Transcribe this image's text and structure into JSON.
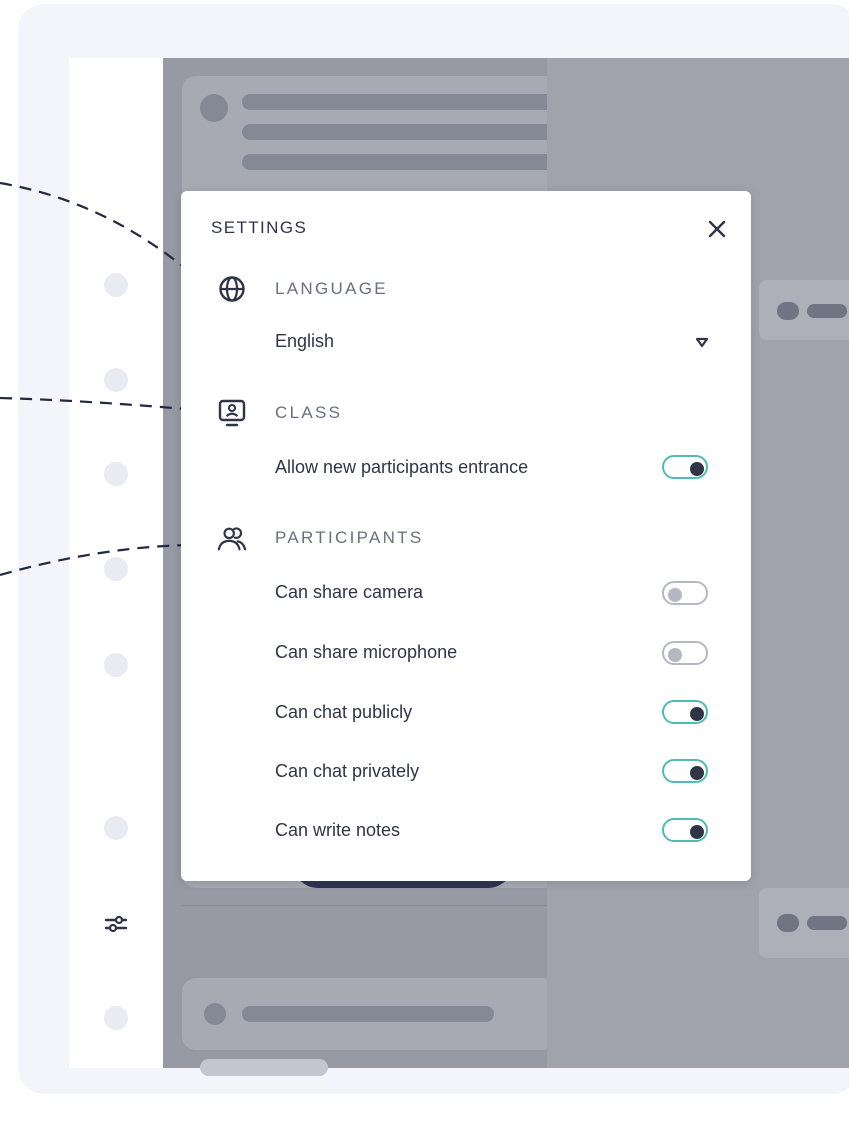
{
  "settings_modal": {
    "title": "SETTINGS",
    "close_icon": "close-icon",
    "sections": {
      "language": {
        "icon": "globe-icon",
        "title": "LANGUAGE",
        "selected": "English"
      },
      "class": {
        "icon": "presentation-screen-icon",
        "title": "CLASS",
        "options": [
          {
            "label": "Allow new participants entrance",
            "enabled": true
          }
        ]
      },
      "participants": {
        "icon": "users-icon",
        "title": "PARTICIPANTS",
        "options": [
          {
            "label": "Can share camera",
            "enabled": false
          },
          {
            "label": "Can share microphone",
            "enabled": false
          },
          {
            "label": "Can chat publicly",
            "enabled": true
          },
          {
            "label": "Can chat privately",
            "enabled": true
          },
          {
            "label": "Can write notes",
            "enabled": true
          }
        ]
      }
    }
  },
  "colors": {
    "toggle_on_border": "#4fbcb3",
    "toggle_knob_on": "#2f3547",
    "toggle_off": "#b5b8c3",
    "overlay": "#979aa4",
    "text_primary": "#2f3547",
    "text_section": "#6a6f80"
  },
  "rail": {
    "settings_icon": "sliders-icon"
  },
  "background_panel": {
    "notes_icon": "notes-icon"
  }
}
